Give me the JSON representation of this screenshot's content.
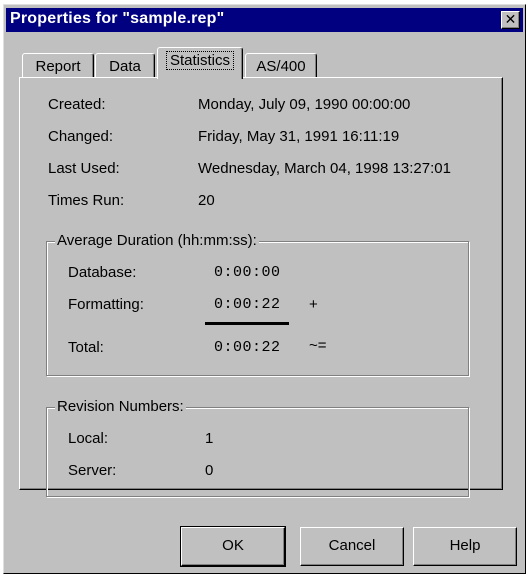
{
  "window": {
    "title": "Properties for \"sample.rep\"",
    "close_glyph": "✕"
  },
  "tabs": [
    "Report",
    "Data",
    "Statistics",
    "AS/400"
  ],
  "active_tab": "Statistics",
  "stats": {
    "created_label": "Created:",
    "created_value": "Monday, July 09, 1990 00:00:00",
    "changed_label": "Changed:",
    "changed_value": "Friday, May 31, 1991 16:11:19",
    "last_used_label": "Last Used:",
    "last_used_value": "Wednesday, March 04, 1998 13:27:01",
    "times_run_label": "Times Run:",
    "times_run_value": "20"
  },
  "duration": {
    "title": "Average Duration (hh:mm:ss):",
    "database_label": "Database:",
    "database_value": "0:00:00",
    "formatting_label": "Formatting:",
    "formatting_value": "0:00:22",
    "plus_symbol": "+",
    "total_label": "Total:",
    "total_value": "0:00:22",
    "approx_symbol": "~="
  },
  "revision": {
    "title": "Revision Numbers:",
    "local_label": "Local:",
    "local_value": "1",
    "server_label": "Server:",
    "server_value": "0"
  },
  "buttons": {
    "ok": "OK",
    "cancel": "Cancel",
    "help": "Help"
  }
}
